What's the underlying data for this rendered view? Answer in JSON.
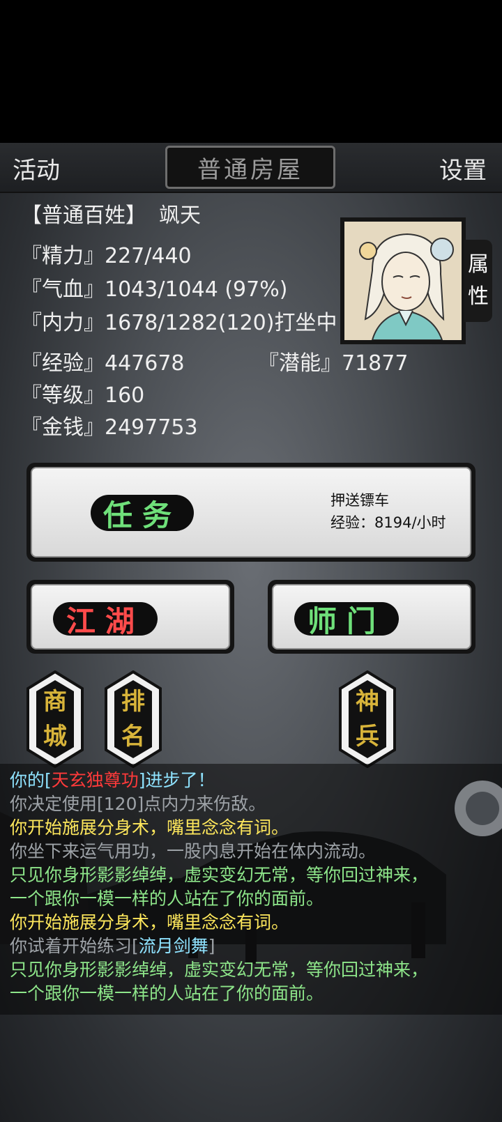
{
  "topbar": {
    "activity": "活动",
    "title": "普通房屋",
    "settings": "设置"
  },
  "player": {
    "rank": "【普通百姓】",
    "name": "飒天",
    "stats": {
      "energy": "『精力』227/440",
      "health": "『气血』1043/1044 (97%)",
      "force": "『内力』1678/1282(120)打坐中",
      "exp": "『经验』447678",
      "potential": "『潜能』71877",
      "level": "『等级』160",
      "money": "『金钱』2497753"
    },
    "attributes_tab": [
      "属",
      "性"
    ]
  },
  "task": {
    "button": "任务",
    "name": "押送镖车",
    "reward": "经验：8194/小时"
  },
  "jianghu": "江湖",
  "shimen": "师门",
  "side_buttons": {
    "shop": [
      "商",
      "城"
    ],
    "rank": [
      "排",
      "名"
    ],
    "weapon": [
      "神",
      "兵"
    ]
  },
  "log": [
    {
      "pre": "你的[",
      "hl": "天玄独尊功",
      "post": "]进步了！"
    },
    "你决定使用[120]点内力来伤敌。",
    "你开始施展分身术，嘴里念念有词。",
    "你坐下来运气用功，一股内息开始在体内流动。",
    "只见你身形影影绰绰，虚实变幻无常，等你回过神来，",
    "一个跟你一模一样的人站在了你的面前。",
    "你开始施展分身术，嘴里念念有词。",
    {
      "pre": "你试着开始练习[",
      "hl": "流月剑舞",
      "post": "]"
    },
    "只见你身形影影绰绰，虚实变幻无常，等你回过神来，",
    "一个跟你一模一样的人站在了你的面前。"
  ],
  "colors": {
    "green_label": "#6fe07a",
    "red_label": "#ff4b4b",
    "gold_label": "#d8b43a"
  }
}
